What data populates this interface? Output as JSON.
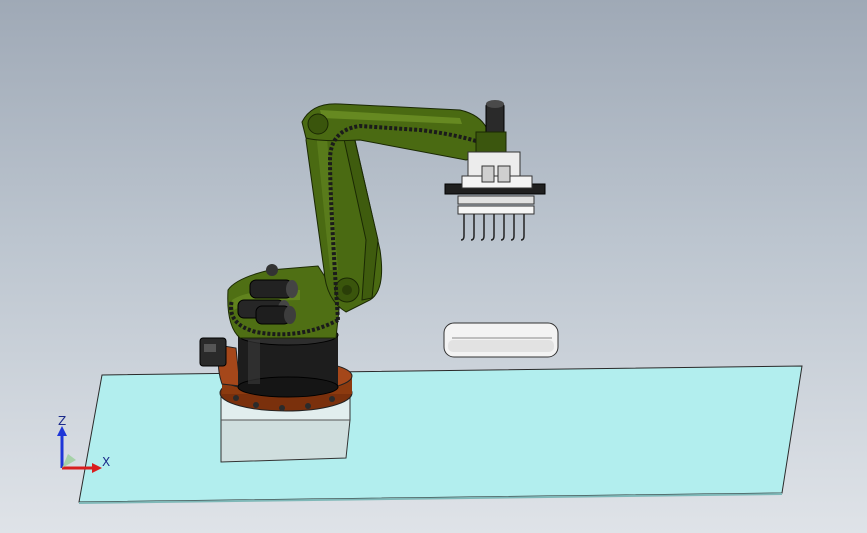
{
  "viewport": {
    "background_top": "#9fa9b6",
    "background_bottom": "#dfe3e8"
  },
  "colors": {
    "floor": "#b2eeee",
    "pedestal": "#d8e6e6",
    "robot_arm": "#4a6a12",
    "robot_base": "#1d1d1d",
    "turntable": "#8c3a0f",
    "gripper": "#e8e8e8",
    "workpiece": "#f2f2f2",
    "axis_z": "#1e36d8",
    "axis_x": "#d81e1e"
  },
  "triad": {
    "z_label": "Z",
    "x_label": "X"
  }
}
